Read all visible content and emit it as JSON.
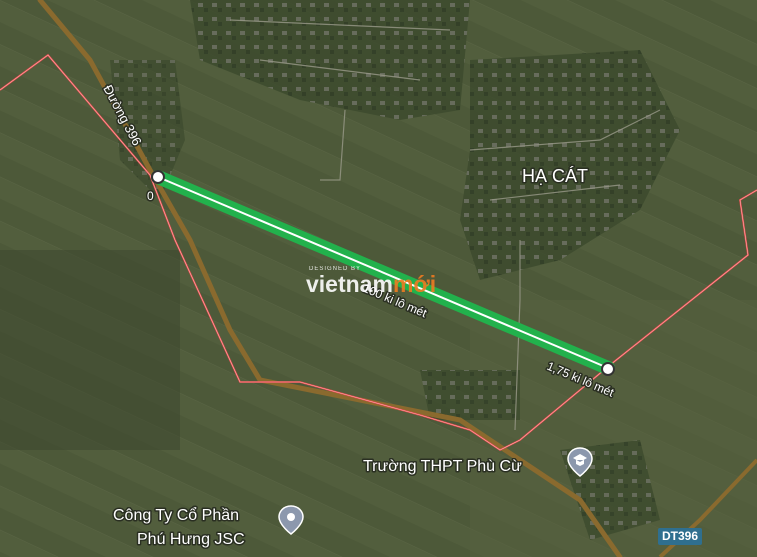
{
  "map": {
    "area_label": "HẠ CÁT",
    "road_label": "Đường 396",
    "road_badge": "DT396",
    "start_marker": "0",
    "mid_measure": "100 ki lô mét",
    "end_measure": "1,75 ki lô mét",
    "poi": [
      {
        "name": "Trường THPT Phù Cừ",
        "icon": "school-pin-icon"
      },
      {
        "name_line1": "Công Ty Cổ Phần",
        "name_line2": "Phú Hưng JSC",
        "icon": "location-pin-icon"
      }
    ],
    "watermark": {
      "designed_by": "DESIGNED BY",
      "brand_a": "vietnam",
      "brand_b": "mới"
    },
    "colors": {
      "route": "#22b14c",
      "boundary": "#e04a4a",
      "road": "#8a6a2e",
      "terrain": "#4a5537"
    }
  }
}
